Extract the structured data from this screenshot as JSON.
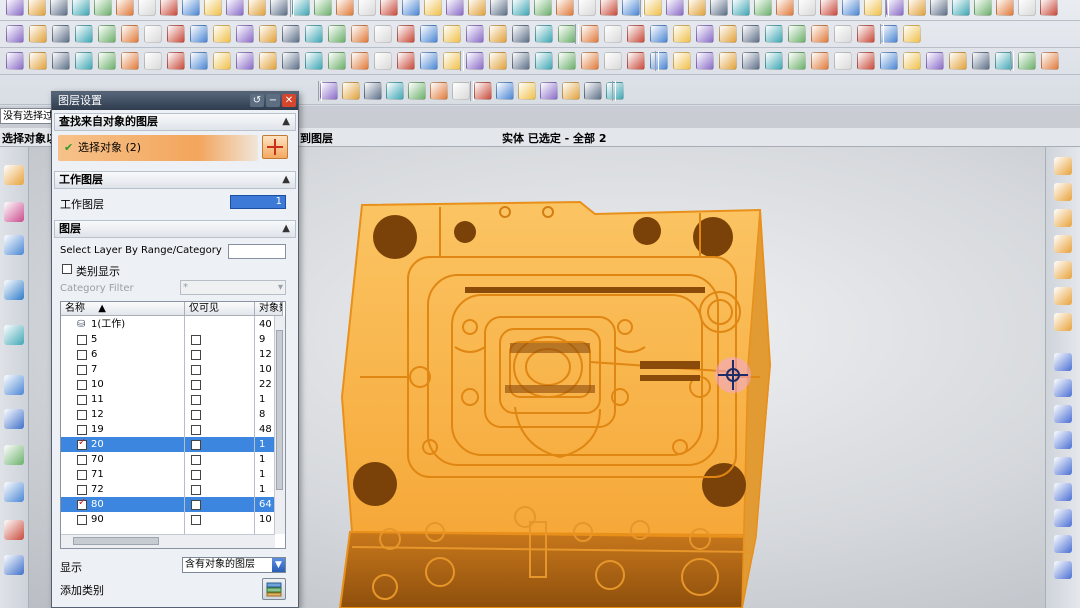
{
  "selection_filter": {
    "value": "没有选择过"
  },
  "status_bar": {
    "left": "选择对象以",
    "middle": "到图层",
    "right": "实体 已选定 - 全部 2"
  },
  "dialog": {
    "title": "图层设置",
    "section_find": {
      "title": "查找来自对象的图层",
      "selected_label": "选择对象 (2)"
    },
    "section_work": {
      "title": "工作图层",
      "field_label": "工作图层",
      "field_value": "1"
    },
    "section_layers": {
      "title": "图层",
      "range_label": "Select Layer By Range/Category",
      "range_value": "",
      "category_display_label": "类别显示",
      "category_filter_label": "Category Filter",
      "category_filter_value": "*"
    },
    "table": {
      "columns": [
        "名称",
        "仅可见",
        "对象数"
      ],
      "rows": [
        {
          "name": "1(工作)",
          "visible_only": false,
          "count": "40",
          "checked": false,
          "selected": false,
          "work": true
        },
        {
          "name": "5",
          "visible_only": false,
          "count": "9",
          "checked": false,
          "selected": false
        },
        {
          "name": "6",
          "visible_only": false,
          "count": "12",
          "checked": false,
          "selected": false
        },
        {
          "name": "7",
          "visible_only": false,
          "count": "10",
          "checked": false,
          "selected": false
        },
        {
          "name": "10",
          "visible_only": false,
          "count": "22",
          "checked": false,
          "selected": false
        },
        {
          "name": "11",
          "visible_only": false,
          "count": "1",
          "checked": false,
          "selected": false
        },
        {
          "name": "12",
          "visible_only": false,
          "count": "8",
          "checked": false,
          "selected": false
        },
        {
          "name": "19",
          "visible_only": false,
          "count": "48",
          "checked": false,
          "selected": false
        },
        {
          "name": "20",
          "visible_only": false,
          "count": "1",
          "checked": true,
          "selected": true
        },
        {
          "name": "70",
          "visible_only": false,
          "count": "1",
          "checked": false,
          "selected": false
        },
        {
          "name": "71",
          "visible_only": false,
          "count": "1",
          "checked": false,
          "selected": false
        },
        {
          "name": "72",
          "visible_only": false,
          "count": "1",
          "checked": false,
          "selected": false
        },
        {
          "name": "80",
          "visible_only": false,
          "count": "64",
          "checked": true,
          "selected": true
        },
        {
          "name": "90",
          "visible_only": false,
          "count": "10",
          "checked": false,
          "selected": false
        }
      ]
    },
    "show_label": "显示",
    "show_value": "含有对象的图层",
    "add_category_label": "添加类别"
  },
  "colors": {
    "model_fill": "#f9b34a",
    "model_edge": "#e58a12",
    "selection_blue": "#3d86e0",
    "dialog_title": "#2f3c4e"
  }
}
